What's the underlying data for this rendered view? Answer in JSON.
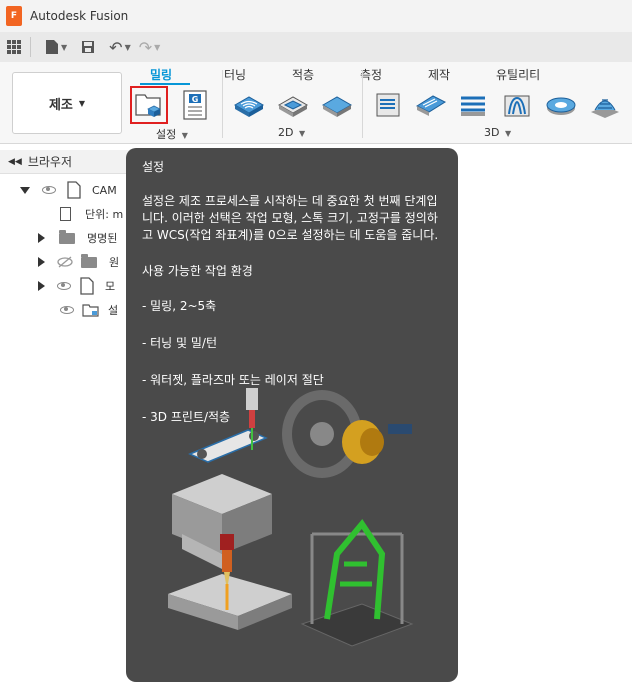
{
  "app": {
    "title": "Autodesk Fusion",
    "logo_letter": "F"
  },
  "quickbar": {
    "grid_icon": "grid-icon",
    "file_icon": "file-icon",
    "save_icon": "save-icon",
    "undo_icon": "undo-icon",
    "redo_icon": "redo-icon"
  },
  "ribbon": {
    "workspace_label": "제조",
    "tabs": [
      {
        "label": "밀링",
        "active": true
      },
      {
        "label": "터닝"
      },
      {
        "label": "적층"
      },
      {
        "label": "측정"
      },
      {
        "label": "제작"
      },
      {
        "label": "유틸리티"
      }
    ],
    "groups": {
      "setup": "설정",
      "twod": "2D",
      "threed": "3D"
    }
  },
  "browser": {
    "title": "브라우저",
    "rows": [
      {
        "label": "CAM"
      },
      {
        "label": "단위: m"
      },
      {
        "label": "명명된"
      },
      {
        "label": "원"
      },
      {
        "label": "모"
      },
      {
        "label": "설"
      }
    ]
  },
  "tooltip": {
    "title": "설정",
    "body": "설정은 제조 프로세스를 시작하는 데 중요한 첫 번째 단계입니다. 이러한 선택은 작업 모형, 스톡 크기, 고정구를 정의하고 WCS(작업 좌표계)를 0으로 설정하는 데 도움을 줍니다.",
    "subtitle": "사용 가능한 작업 환경",
    "items": [
      "- 밀링, 2~5축",
      "- 터닝 및 밀/턴",
      "- 워터젯, 플라즈마 또는 레이저 절단",
      "- 3D 프린트/적층"
    ]
  },
  "colors": {
    "accent": "#0696d7",
    "highlight": "#e02020",
    "tooltip_bg": "#4a4a4a"
  }
}
